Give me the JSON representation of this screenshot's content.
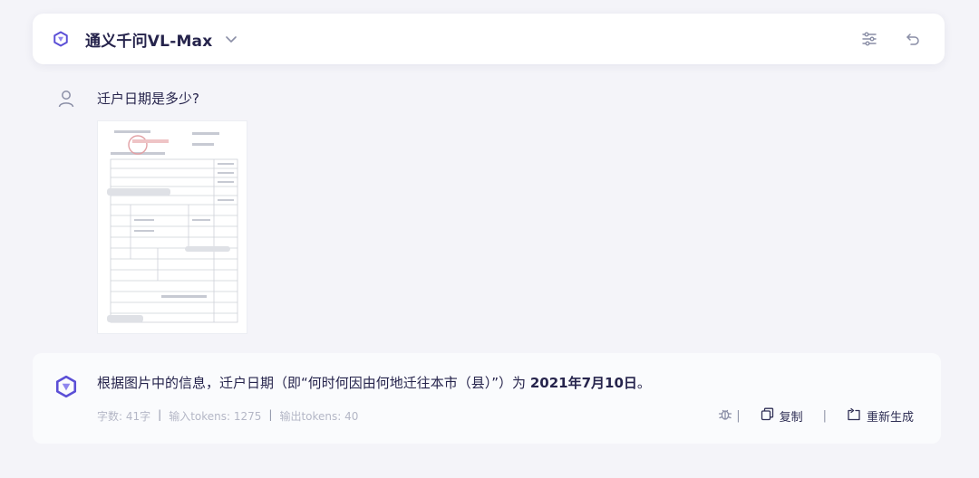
{
  "header": {
    "model_name": "通义千问VL-Max",
    "icons": [
      "tongyi-logo",
      "chevron-down",
      "settings-sliders",
      "undo"
    ]
  },
  "conversation": {
    "user_question": "迁户日期是多少?",
    "attachment": {
      "kind": "image",
      "description": "household registration document thumbnail"
    },
    "answer": {
      "prefix": "根据图片中的信息，迁户日期（即“何时何因由何地迁往本市（县）”）为 ",
      "highlight": "2021年7月10日",
      "suffix": "。"
    },
    "meta": {
      "chars": "字数: 41字",
      "input_tokens": "输入tokens: 1275",
      "output_tokens": "输出tokens: 40",
      "separator": "|"
    },
    "actions": {
      "separator": "|",
      "copy_label": "复制",
      "regenerate_label": "重新生成"
    }
  },
  "colors": {
    "background": "#f4f4f9",
    "accent": "#5b4fd6",
    "text": "#26244c",
    "muted": "#b4b7c6"
  }
}
